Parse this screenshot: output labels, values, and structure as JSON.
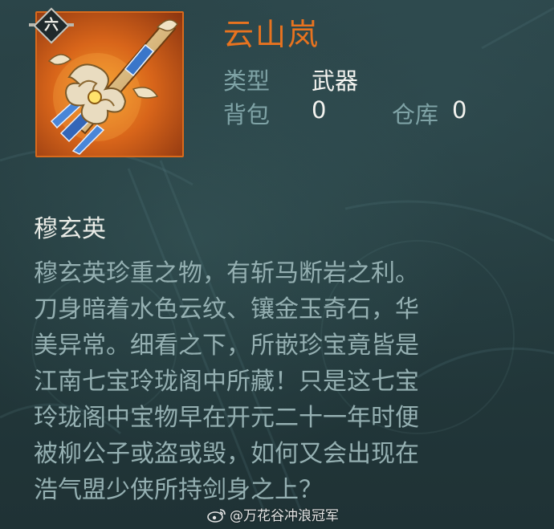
{
  "item": {
    "tier": "六",
    "name": "云山岚",
    "type_label": "类型",
    "type_value": "武器",
    "bag_label": "背包",
    "bag_count": "0",
    "warehouse_label": "仓库",
    "warehouse_count": "0",
    "icon": "ornate-sword-icon"
  },
  "subtitle": "穆玄英",
  "description": [
    "穆玄英珍重之物，有斩马断岩之利。",
    "刀身暗着水色云纹、镶金玉奇石，华",
    "美异常。细看之下，所嵌珍宝竟皆是",
    "江南七宝玲珑阁中所藏！只是这七宝",
    "玲珑阁中宝物早在开元二十一年时便",
    "被柳公子或盗或毁，如何又会出现在",
    "浩气盟少侠所持剑身之上？"
  ],
  "watermark": "@万花谷冲浪冠军",
  "colors": {
    "item_name": "#e8731f",
    "label": "#7fa3a6",
    "value": "#f3f3ef",
    "description": "#95b0b2",
    "icon_border": "#d96a1c"
  }
}
